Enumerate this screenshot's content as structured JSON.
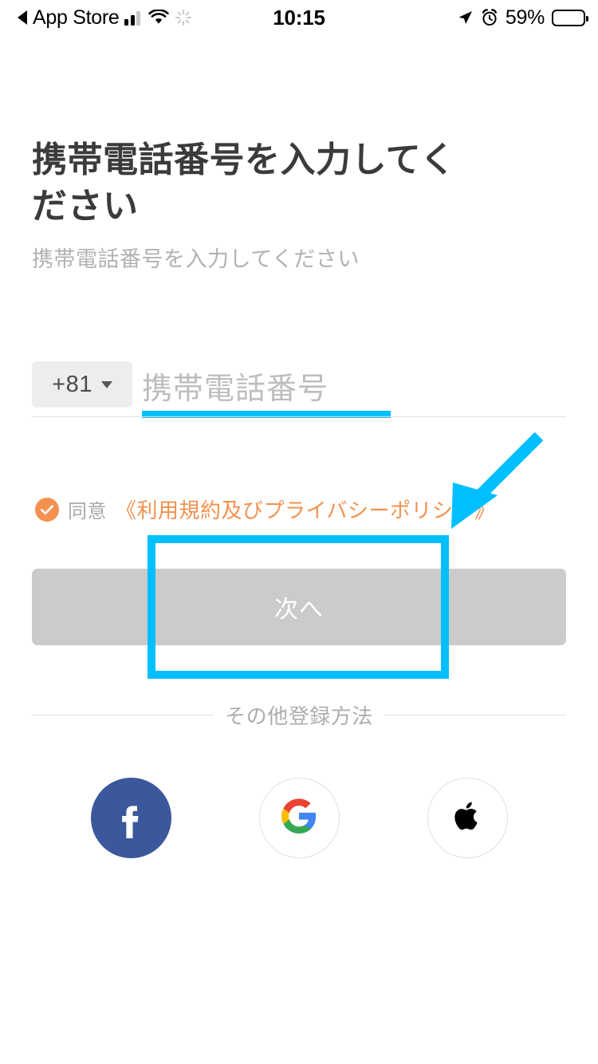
{
  "status_bar": {
    "back_label": "App Store",
    "back_icon": "left-triangle-icon",
    "signal_icon": "cellular-signal-icon",
    "wifi_icon": "wifi-icon",
    "activity_icon": "activity-spinner-icon",
    "time": "10:15",
    "location_icon": "location-arrow-icon",
    "alarm_icon": "alarm-clock-icon",
    "battery_percent": "59%",
    "battery_icon": "battery-icon",
    "battery_level": 59
  },
  "page": {
    "title": "携帯電話番号を入力してください",
    "subtitle": "携帯電話番号を入力してください"
  },
  "phone": {
    "country_code": "+81",
    "country_caret_icon": "chevron-down-icon",
    "placeholder": "携帯電話番号",
    "value": "",
    "underline_color": "#00bfff"
  },
  "agreement": {
    "checked": true,
    "check_icon": "check-circle-icon",
    "label": "同意",
    "terms_text": "《利用規約及びプライバシーポリシー》",
    "accent_color": "#f4914f"
  },
  "next_button": {
    "label": "次へ",
    "enabled": false,
    "background": "#cbcbcb",
    "text_color": "#ffffff"
  },
  "annotation": {
    "rect_color": "#00bfff",
    "arrow_color": "#00bfff",
    "arrow_icon": "pointer-arrow-icon",
    "highlight_icon": "highlight-rectangle-icon"
  },
  "divider": {
    "text": "その他登録方法"
  },
  "social": [
    {
      "name": "facebook",
      "icon": "facebook-icon",
      "color": "#3a589b"
    },
    {
      "name": "google",
      "icon": "google-icon",
      "color": "#ffffff"
    },
    {
      "name": "apple",
      "icon": "apple-icon",
      "color": "#ffffff"
    }
  ]
}
